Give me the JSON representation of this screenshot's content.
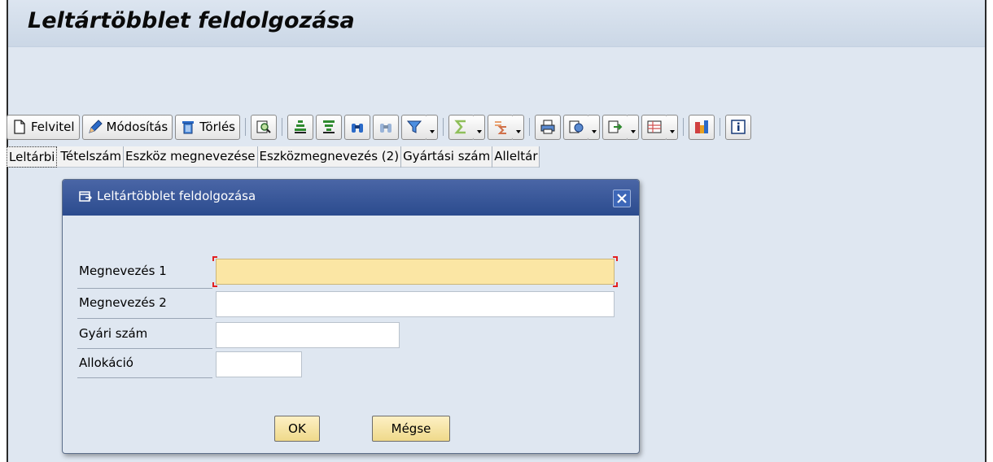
{
  "window": {
    "title": "Leltártöbblet feldolgozása"
  },
  "toolbar": {
    "create_label": "Felvitel",
    "change_label": "Módosítás",
    "delete_label": "Törlés"
  },
  "columns": [
    "Leltárbi",
    "Tételszám",
    "Eszköz megnevezése",
    "Eszközmegnevezés (2)",
    "Gyártási szám",
    "Alleltár"
  ],
  "dialog": {
    "title": "Leltártöbblet feldolgozása",
    "fields": [
      {
        "label": "Megnevezés 1",
        "value": ""
      },
      {
        "label": "Megnevezés 2",
        "value": ""
      },
      {
        "label": "Gyári szám",
        "value": ""
      },
      {
        "label": "Allokáció",
        "value": ""
      }
    ],
    "ok_label": "OK",
    "cancel_label": "Mégse"
  },
  "colors": {
    "dialog_title_bg": "#2b4b8e",
    "focused_field_bg": "#fbe6a4",
    "button_bg": "#efd98a",
    "background": "#dfe7f1"
  }
}
